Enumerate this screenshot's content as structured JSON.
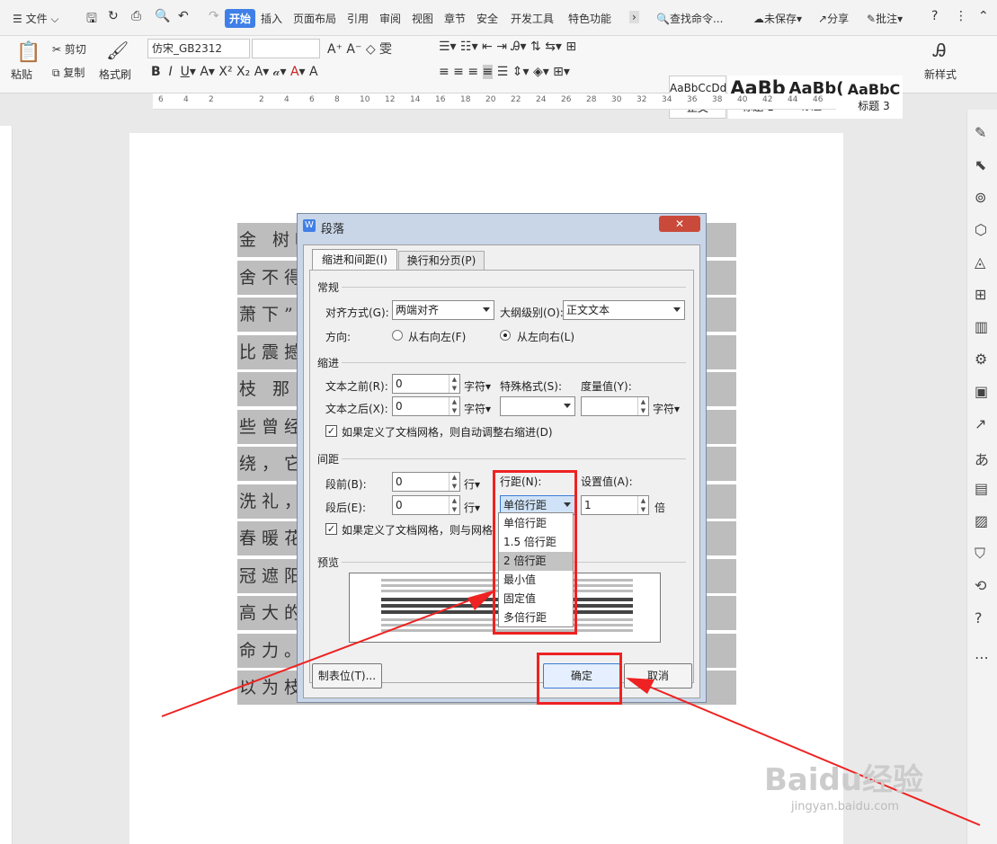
{
  "menubar": {
    "file": "文件",
    "tabs": [
      "开始",
      "插入",
      "页面布局",
      "引用",
      "审阅",
      "视图",
      "章节",
      "安全",
      "开发工具",
      "特色功能"
    ],
    "search": "查找命令...",
    "unsaved": "未保存",
    "share": "分享",
    "comment": "批注"
  },
  "ribbon": {
    "paste": "粘贴",
    "cut": "剪切",
    "copy": "复制",
    "format_painter": "格式刷",
    "font": "仿宋_GB2312",
    "styles": [
      {
        "preview": "AaBbCcDd",
        "name": "正文"
      },
      {
        "preview": "AaBb",
        "name": "标题 1"
      },
      {
        "preview": "AaBb(",
        "name": "标题 2"
      },
      {
        "preview": "AaBbC",
        "name": "标题 3"
      }
    ],
    "new_style": "新样式"
  },
  "ruler": {
    "ticks": [
      "6",
      "4",
      "2",
      "",
      "2",
      "4",
      "6",
      "8",
      "10",
      "12",
      "14",
      "16",
      "18",
      "20",
      "22",
      "24",
      "26",
      "28",
      "30",
      "32",
      "34",
      "36",
      "38",
      "40",
      "42",
      "44",
      "46"
    ]
  },
  "document": {
    "lines": [
      "金                                  树叶",
      "舍不得                              大萧",
      "萧下”                              的无",
      "比震撼",
      "    枝                              那",
      "些曾经                              缠",
      "绕，它                              的",
      "洗礼，                              。",
      "春暖花                              树",
      "冠遮阳                              。",
      "高大的                              的生",
      "命力。                              ，",
      "以为枝"
    ]
  },
  "dialog": {
    "title": "段落",
    "tabs": [
      "缩进和间距(I)",
      "换行和分页(P)"
    ],
    "general": {
      "heading": "常规",
      "align_label": "对齐方式(G):",
      "align_value": "两端对齐",
      "outline_label": "大纲级别(O):",
      "outline_value": "正文文本",
      "direction_label": "方向:",
      "rtl": "从右向左(F)",
      "ltr": "从左向右(L)"
    },
    "indent": {
      "heading": "缩进",
      "before_label": "文本之前(R):",
      "before_value": "0",
      "after_label": "文本之后(X):",
      "after_value": "0",
      "unit": "字符▾",
      "special_label": "特殊格式(S):",
      "measure_label": "度量值(Y):",
      "measure_unit": "字符▾",
      "auto_adjust": "如果定义了文档网格，则自动调整右缩进(D)"
    },
    "spacing": {
      "heading": "间距",
      "before_label": "段前(B):",
      "before_value": "0",
      "after_label": "段后(E):",
      "after_value": "0",
      "unit": "行▾",
      "line_label": "行距(N):",
      "line_value": "单倍行距",
      "setting_label": "设置值(A):",
      "setting_value": "1",
      "setting_unit": "倍",
      "grid_align": "如果定义了文档网格，则与网格对齐"
    },
    "preview": {
      "heading": "预览"
    },
    "tab_stops": "制表位(T)...",
    "ok": "确定",
    "cancel": "取消",
    "line_options": [
      "单倍行距",
      "1.5 倍行距",
      "2 倍行距",
      "最小值",
      "固定值",
      "多倍行距"
    ]
  },
  "watermark": {
    "brand": "Baidu经验",
    "url": "jingyan.baidu.com"
  },
  "colors": {
    "accent": "#3f7fe7",
    "highlight": "#e22222"
  }
}
